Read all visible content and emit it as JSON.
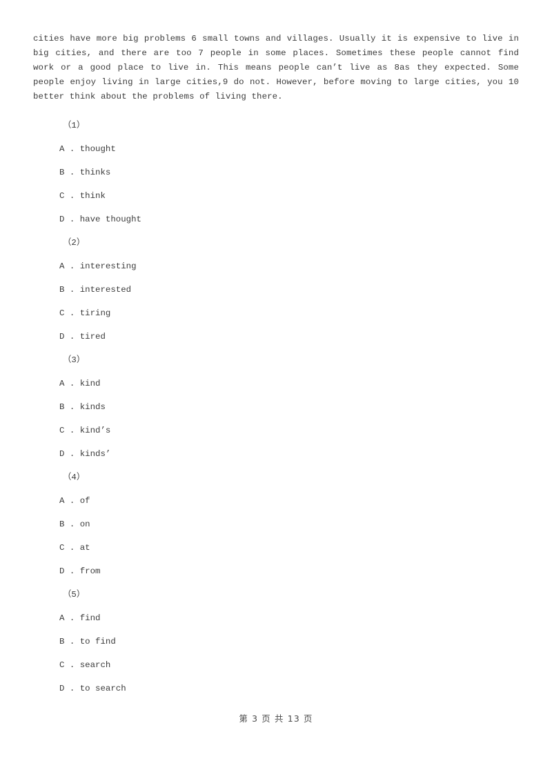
{
  "document": {
    "passage": "cities have more big problems 6 small towns and villages. Usually it is expensive to live in big cities, and there are too 7 people in some places. Sometimes these people cannot find work or a good place to live in. This means people can’t live as 8as they expected. Some people enjoy living in large cities,9 do not. However, before moving to large cities, you 10 better think about the problems of living there."
  },
  "questions": [
    {
      "number": "（1）",
      "options": [
        "A . thought",
        "B . thinks",
        "C . think",
        "D . have thought"
      ]
    },
    {
      "number": "（2）",
      "options": [
        "A . interesting",
        "B . interested",
        "C . tiring",
        "D . tired"
      ]
    },
    {
      "number": "（3）",
      "options": [
        "A . kind",
        "B . kinds",
        "C . kind’s",
        "D . kinds’"
      ]
    },
    {
      "number": "（4）",
      "options": [
        "A . of",
        "B . on",
        "C . at",
        "D . from"
      ]
    },
    {
      "number": "（5）",
      "options": [
        "A . find",
        "B . to find",
        "C . search",
        "D . to search"
      ]
    }
  ],
  "footer": {
    "page_label": "第 3 页 共 13 页"
  }
}
